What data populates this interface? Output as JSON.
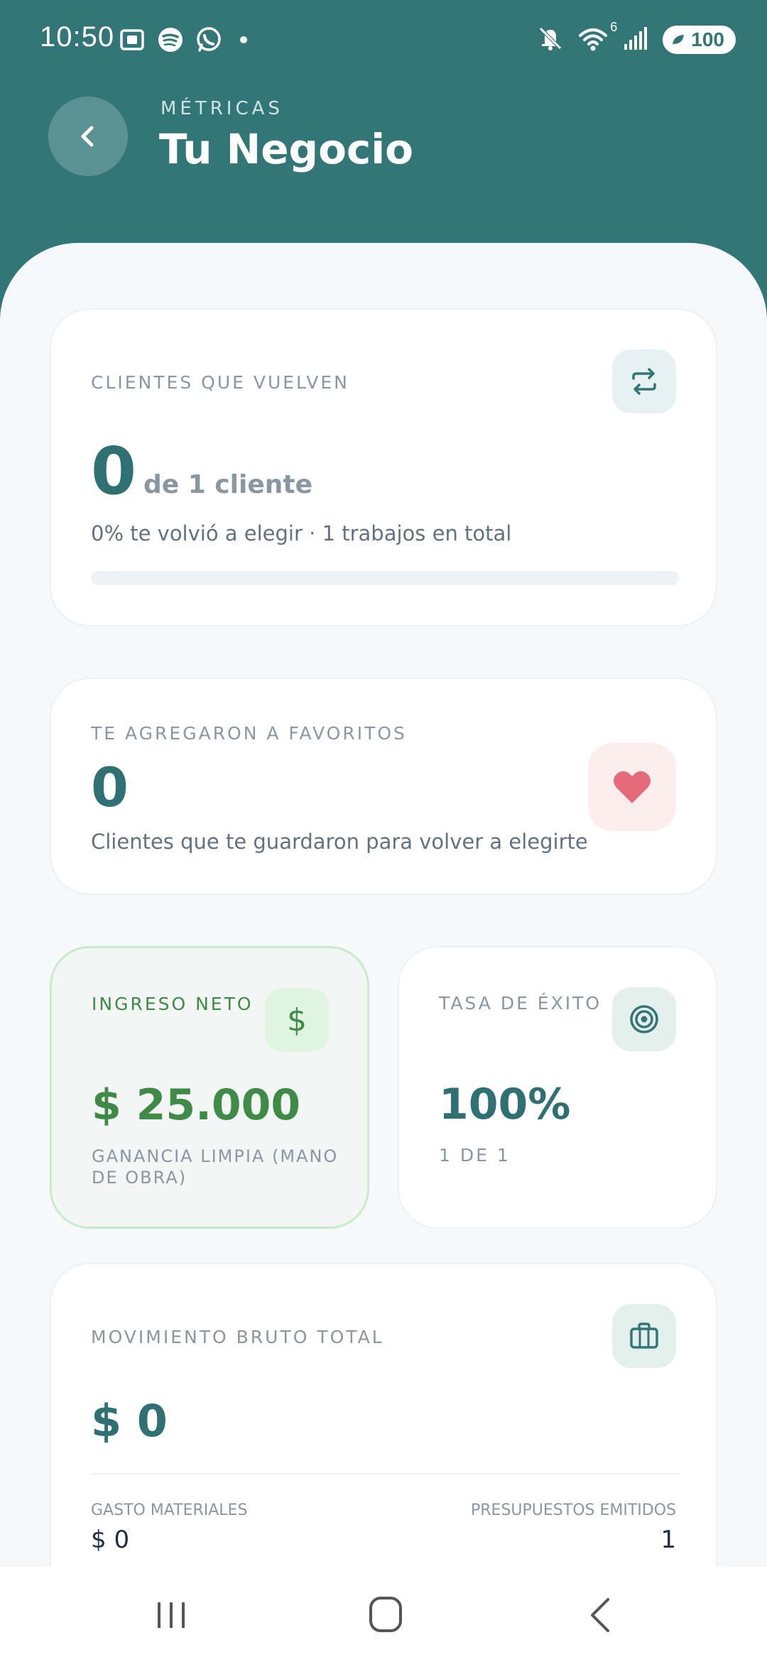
{
  "status_bar": {
    "time": "10:50",
    "battery": "100",
    "network_badge": "6",
    "icons_left": [
      "screenshot-icon",
      "spotify-icon",
      "whatsapp-icon",
      "dot-icon"
    ],
    "icons_right": [
      "mute-icon",
      "wifi-icon",
      "signal-icon",
      "battery-icon"
    ]
  },
  "header": {
    "kicker": "MÉTRICAS",
    "title": "Tu Negocio"
  },
  "returning_clients": {
    "label": "CLIENTES QUE VUELVEN",
    "value": "0",
    "of_text": "de 1 cliente",
    "subtitle": "0% te volvió a elegir · 1 trabajos en total",
    "progress_percent": 0,
    "icon": "repeat-icon"
  },
  "favorites": {
    "label": "TE AGREGARON A FAVORITOS",
    "value": "0",
    "subtitle": "Clientes que te guardaron para volver a elegirte",
    "icon": "heart-icon"
  },
  "net_income": {
    "label": "INGRESO NETO",
    "value": "$ 25.000",
    "subtitle": "GANANCIA LIMPIA (MANO DE OBRA)",
    "icon": "dollar-icon"
  },
  "success_rate": {
    "label": "TASA DE ÉXITO",
    "value": "100%",
    "subtitle": "1 DE 1",
    "icon": "target-icon"
  },
  "gross_total": {
    "label": "MOVIMIENTO BRUTO TOTAL",
    "value": "$ 0",
    "icon": "briefcase-icon",
    "materials_label": "GASTO MATERIALES",
    "materials_value": "$ 0",
    "quotes_label": "PRESUPUESTOS EMITIDOS",
    "quotes_value": "1"
  },
  "colors": {
    "header": "#337677",
    "primary_text": "#2f7173",
    "income_green": "#3f8a47",
    "heart": "#e56b7a"
  },
  "nav": [
    "recents-icon",
    "home-icon",
    "back-nav-icon"
  ]
}
